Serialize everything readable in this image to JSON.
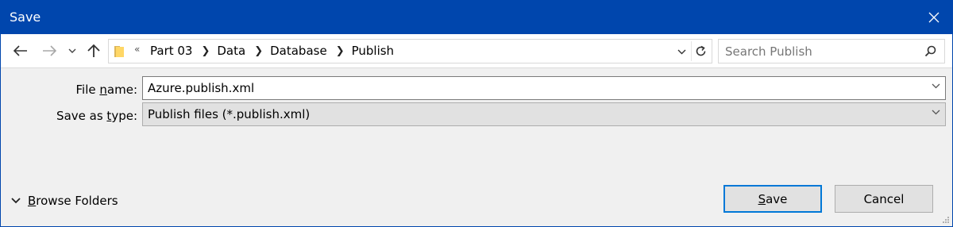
{
  "window": {
    "title": "Save"
  },
  "nav": {
    "breadcrumb": [
      "Part 03",
      "Data",
      "Database",
      "Publish"
    ],
    "overflow_glyph": "«"
  },
  "search": {
    "placeholder": "Search Publish"
  },
  "form": {
    "filename_label_pre": "File ",
    "filename_label_key": "n",
    "filename_label_post": "ame:",
    "filename_value": "Azure.publish.xml",
    "type_label_pre": "Save as ",
    "type_label_key": "t",
    "type_label_post": "ype:",
    "type_value": "Publish files (*.publish.xml)"
  },
  "footer": {
    "browse_key": "B",
    "browse_rest": "rowse Folders",
    "save_key": "S",
    "save_rest": "ave",
    "cancel_label": "Cancel"
  },
  "colors": {
    "titlebar": "#0046ad",
    "accent": "#0078d7",
    "folder": "#ffd766"
  }
}
